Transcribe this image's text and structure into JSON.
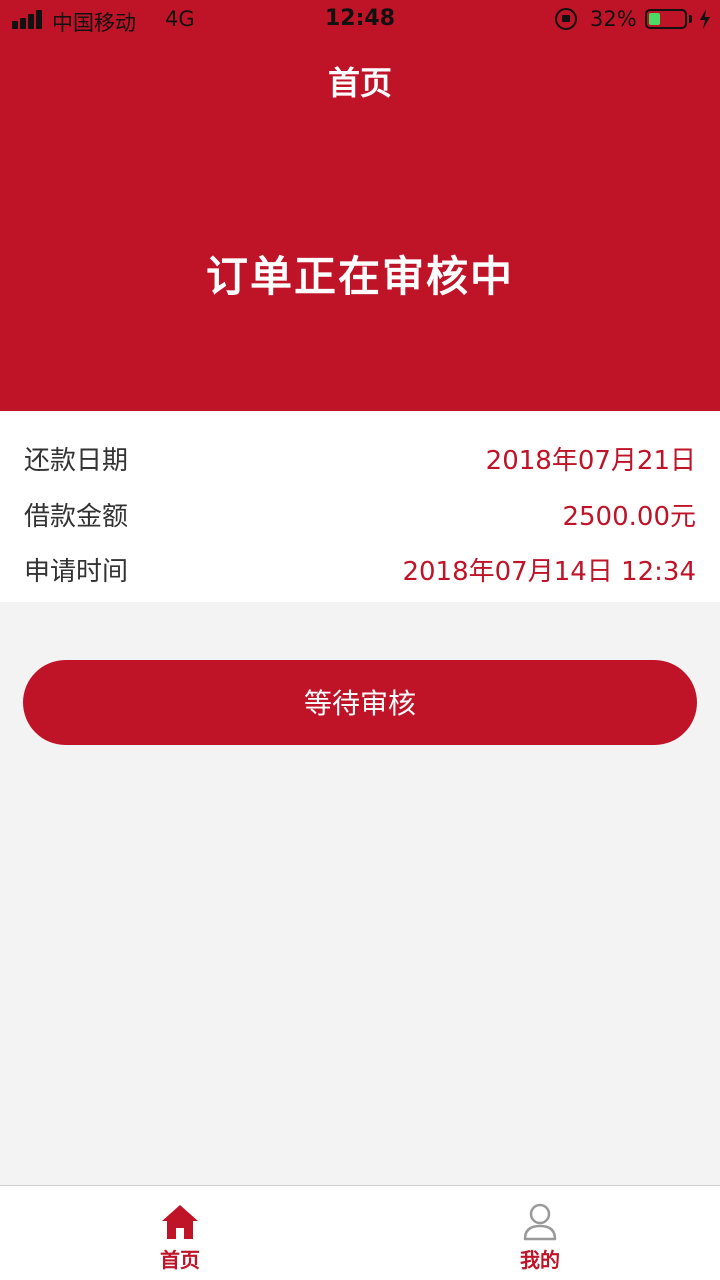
{
  "status_bar": {
    "carrier": "中国移动",
    "network": "4G",
    "time": "12:48",
    "battery_percent": "32%",
    "battery_level": 0.32
  },
  "nav": {
    "title": "首页"
  },
  "order_status": {
    "heading": "订单正在审核中"
  },
  "details": [
    {
      "label": "还款日期",
      "value": "2018年07月21日"
    },
    {
      "label": "借款金额",
      "value": "2500.00元"
    },
    {
      "label": "申请时间",
      "value": "2018年07月14日 12:34"
    }
  ],
  "action": {
    "button_label": "等待审核"
  },
  "tab_bar": {
    "items": [
      {
        "label": "首页",
        "icon": "home-icon",
        "active": true
      },
      {
        "label": "我的",
        "icon": "user-icon",
        "active": false
      }
    ]
  },
  "colors": {
    "brand_red": "#bf1328",
    "page_bg": "#f3f3f4",
    "tab_inactive": "#9a9a9a"
  }
}
